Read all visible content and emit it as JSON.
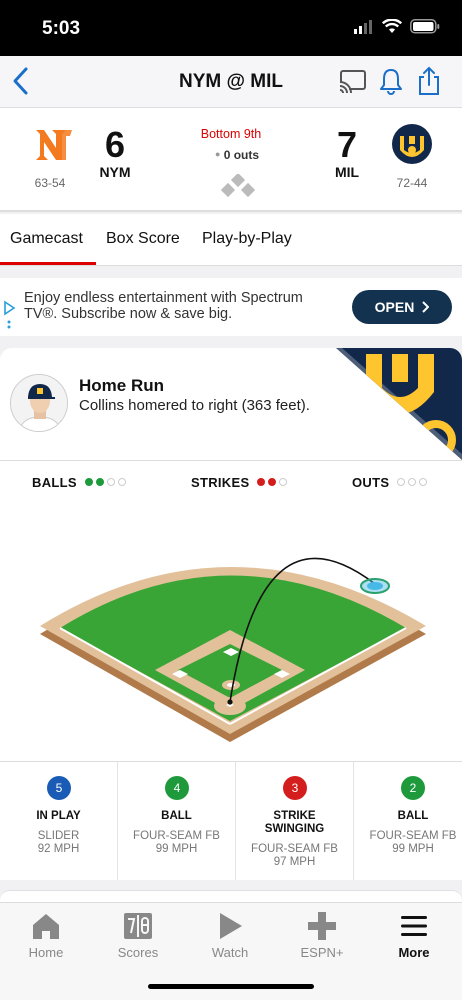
{
  "status_bar": {
    "time": "5:03"
  },
  "header": {
    "title": "NYM @ MIL"
  },
  "scoreboard": {
    "away": {
      "abbr": "NYM",
      "score": "6",
      "record": "63-54"
    },
    "home": {
      "abbr": "MIL",
      "score": "7",
      "record": "72-44"
    },
    "inning": "Bottom 9th",
    "outs": "0 outs"
  },
  "tabs": [
    {
      "label": "Gamecast",
      "active": true
    },
    {
      "label": "Box Score",
      "active": false
    },
    {
      "label": "Play-by-Play",
      "active": false
    }
  ],
  "ad": {
    "text": "Enjoy endless entertainment with Spectrum TV®. Subscribe now & save big.",
    "button": "OPEN"
  },
  "play": {
    "title": "Home Run",
    "description": "Collins homered to right (363 feet)."
  },
  "count": {
    "balls_label": "BALLS",
    "balls": 2,
    "balls_max": 4,
    "strikes_label": "STRIKES",
    "strikes": 2,
    "strikes_max": 3,
    "outs_label": "OUTS",
    "outs": 0,
    "outs_max": 3
  },
  "pitches": [
    {
      "number": "5",
      "result": "IN PLAY",
      "result2": "",
      "type": "SLIDER",
      "speed": "92 MPH",
      "color": "#1a5bb5"
    },
    {
      "number": "4",
      "result": "BALL",
      "result2": "",
      "type": "FOUR-SEAM FB",
      "speed": "99 MPH",
      "color": "#1e9a3c"
    },
    {
      "number": "3",
      "result": "STRIKE",
      "result2": "SWINGING",
      "type": "FOUR-SEAM FB",
      "speed": "97 MPH",
      "color": "#d41d1d"
    },
    {
      "number": "2",
      "result": "BALL",
      "result2": "",
      "type": "FOUR-SEAM FB",
      "speed": "99 MPH",
      "color": "#1e9a3c"
    }
  ],
  "colors": {
    "ball": "#1e9a3c",
    "strike": "#d41d1d",
    "accent": "#d00000",
    "ad_button": "#13324f"
  },
  "tabbar": [
    {
      "label": "Home",
      "icon": "home-icon",
      "active": false
    },
    {
      "label": "Scores",
      "icon": "scoreboard-icon",
      "active": false
    },
    {
      "label": "Watch",
      "icon": "play-icon",
      "active": false
    },
    {
      "label": "ESPN+",
      "icon": "plus-icon",
      "active": false
    },
    {
      "label": "More",
      "icon": "menu-icon",
      "active": true
    }
  ]
}
